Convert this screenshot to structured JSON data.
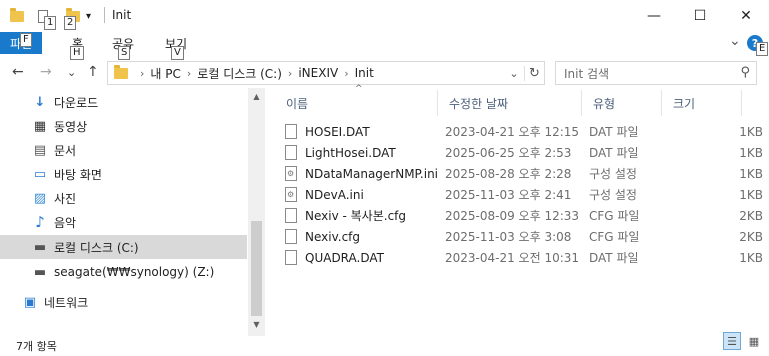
{
  "window": {
    "title": "Init",
    "minimize_glyph": "—",
    "maximize_glyph": "☐",
    "close_glyph": "✕"
  },
  "quick_access": {
    "keytips": [
      "1",
      "2"
    ],
    "customize_glyph": "▾"
  },
  "ribbon": {
    "file_label": "파일",
    "file_keytip": "F",
    "tabs": [
      {
        "label": "홈",
        "keytip": "H"
      },
      {
        "label": "공유",
        "keytip": "S"
      },
      {
        "label": "보기",
        "keytip": "V"
      }
    ],
    "help_keytip": "E",
    "help_glyph": "?",
    "expand_glyph": "⌄"
  },
  "navigation": {
    "back_glyph": "←",
    "forward_glyph": "→",
    "recent_glyph": "⌄",
    "up_glyph": "↑",
    "address_crumbs": [
      "내 PC",
      "로컬 디스크 (C:)",
      "iNEXIV",
      "Init"
    ],
    "crumb_separator": "›",
    "address_dropdown_glyph": "⌄",
    "refresh_glyph": "↻",
    "search_placeholder": "Init 검색",
    "search_glyph": "⚲"
  },
  "nav_pane": {
    "items": [
      {
        "label": "다운로드",
        "icon": "download-icon",
        "glyph": "↓",
        "selected": false
      },
      {
        "label": "동영상",
        "icon": "video-icon",
        "glyph": "▦",
        "selected": false
      },
      {
        "label": "문서",
        "icon": "document-icon",
        "glyph": "▤",
        "selected": false
      },
      {
        "label": "바탕 화면",
        "icon": "desktop-icon",
        "glyph": "▭",
        "selected": false
      },
      {
        "label": "사진",
        "icon": "pictures-icon",
        "glyph": "▨",
        "selected": false
      },
      {
        "label": "음악",
        "icon": "music-icon",
        "glyph": "♪",
        "selected": false
      },
      {
        "label": "로컬 디스크 (C:)",
        "icon": "drive-icon",
        "glyph": "▬",
        "selected": true
      },
      {
        "label": "seagate(₩₩synology) (Z:)",
        "icon": "network-drive-icon",
        "glyph": "▬",
        "selected": false
      },
      {
        "label": "네트워크",
        "icon": "network-icon",
        "glyph": "▣",
        "selected": false
      }
    ],
    "scroll_up_glyph": "▲",
    "scroll_down_glyph": "▼"
  },
  "file_list": {
    "columns": [
      "이름",
      "수정한 날짜",
      "유형",
      "크기"
    ],
    "sort_glyph": "^",
    "files": [
      {
        "name": "HOSEI.DAT",
        "date": "2023-04-21 오후 12:15",
        "type": "DAT 파일",
        "size": "1KB",
        "icon": "file-icon"
      },
      {
        "name": "LightHosei.DAT",
        "date": "2025-06-25 오후 2:53",
        "type": "DAT 파일",
        "size": "1KB",
        "icon": "file-icon"
      },
      {
        "name": "NDataManagerNMP.ini",
        "date": "2025-08-28 오후 2:28",
        "type": "구성 설정",
        "size": "1KB",
        "icon": "settings-file-icon"
      },
      {
        "name": "NDevA.ini",
        "date": "2025-11-03 오후 2:41",
        "type": "구성 설정",
        "size": "1KB",
        "icon": "settings-file-icon"
      },
      {
        "name": "Nexiv - 복사본.cfg",
        "date": "2025-08-09 오후 12:33",
        "type": "CFG 파일",
        "size": "2KB",
        "icon": "file-icon"
      },
      {
        "name": "Nexiv.cfg",
        "date": "2025-11-03 오후 3:08",
        "type": "CFG 파일",
        "size": "2KB",
        "icon": "file-icon"
      },
      {
        "name": "QUADRA.DAT",
        "date": "2023-04-21 오전 10:31",
        "type": "DAT 파일",
        "size": "1KB",
        "icon": "file-icon"
      }
    ]
  },
  "status": {
    "item_count": "7개 항목",
    "details_view_glyph": "☰",
    "large_icons_view_glyph": "▦"
  }
}
